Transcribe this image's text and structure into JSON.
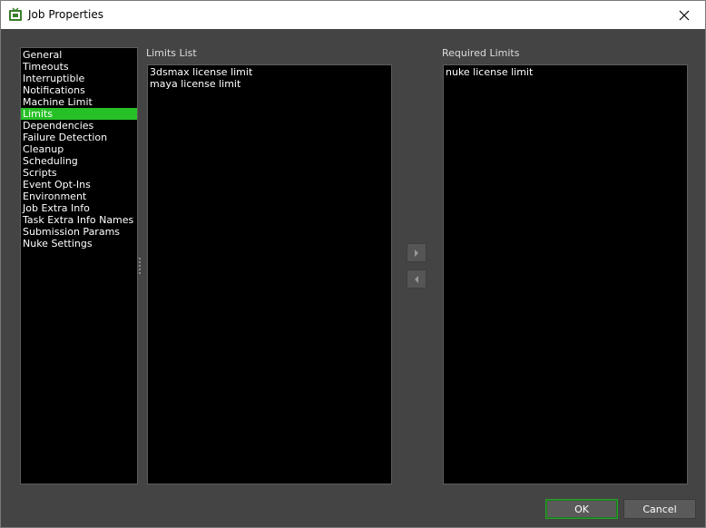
{
  "window": {
    "title": "Job Properties",
    "app_icon": "deadline-monitor-icon",
    "close_icon": "close-icon"
  },
  "nav": {
    "items": [
      {
        "label": "General",
        "selected": false
      },
      {
        "label": "Timeouts",
        "selected": false
      },
      {
        "label": "Interruptible",
        "selected": false
      },
      {
        "label": "Notifications",
        "selected": false
      },
      {
        "label": "Machine Limit",
        "selected": false
      },
      {
        "label": "Limits",
        "selected": true
      },
      {
        "label": "Dependencies",
        "selected": false
      },
      {
        "label": "Failure Detection",
        "selected": false
      },
      {
        "label": "Cleanup",
        "selected": false
      },
      {
        "label": "Scheduling",
        "selected": false
      },
      {
        "label": "Scripts",
        "selected": false
      },
      {
        "label": "Event Opt-Ins",
        "selected": false
      },
      {
        "label": "Environment",
        "selected": false
      },
      {
        "label": "Job Extra Info",
        "selected": false
      },
      {
        "label": "Task Extra Info Names",
        "selected": false
      },
      {
        "label": "Submission Params",
        "selected": false
      },
      {
        "label": "Nuke Settings",
        "selected": false
      }
    ],
    "selected_color": "#27c127"
  },
  "limits_list": {
    "label": "Limits List",
    "items": [
      "3dsmax license limit",
      "maya license limit"
    ]
  },
  "required_limits": {
    "label": "Required Limits",
    "items": [
      "nuke license limit"
    ]
  },
  "transfer": {
    "add_icon": "arrow-right-icon",
    "remove_icon": "arrow-left-icon"
  },
  "buttons": {
    "ok_label": "OK",
    "cancel_label": "Cancel"
  },
  "colors": {
    "background": "#444444",
    "list_background": "#000000",
    "accent": "#27c127"
  }
}
